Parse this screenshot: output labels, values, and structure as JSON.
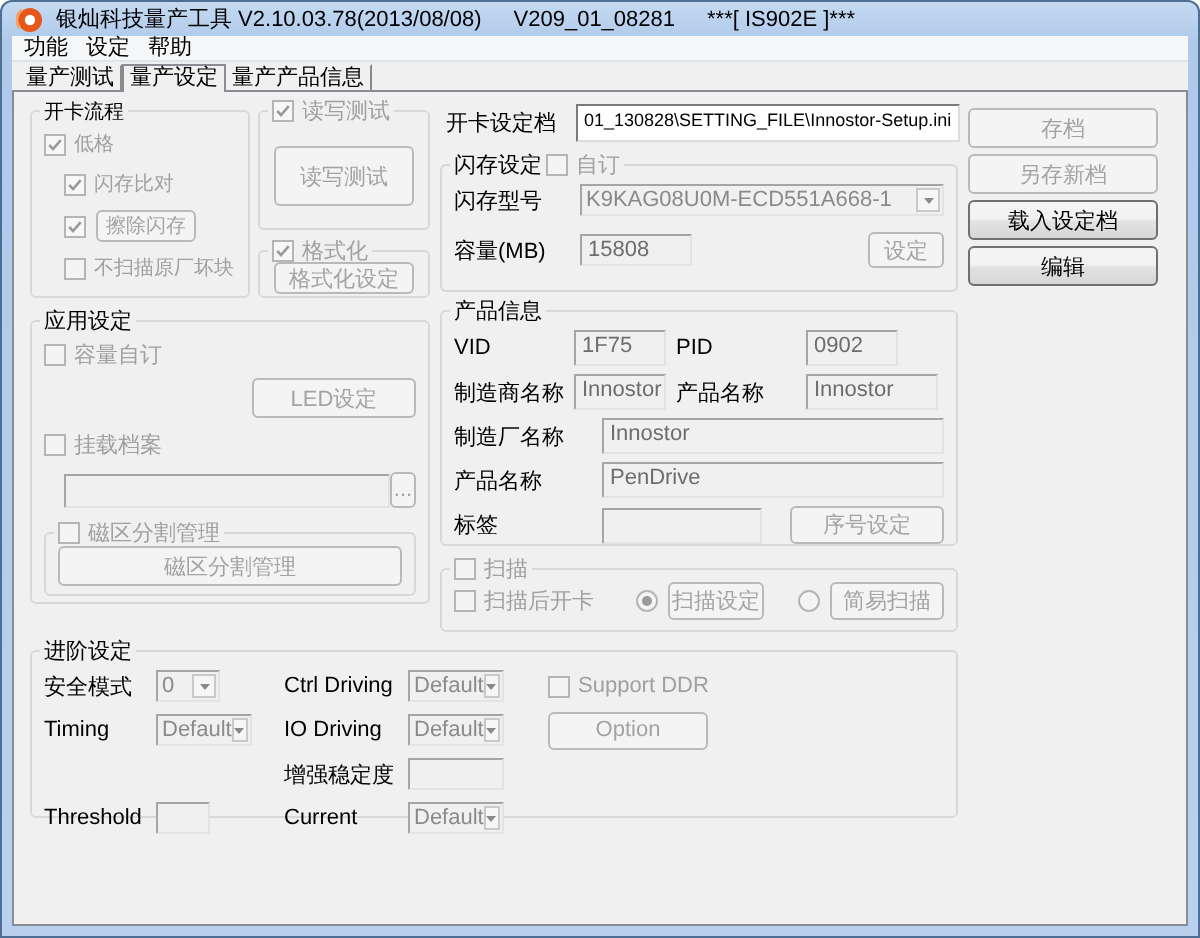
{
  "window": {
    "title": "银灿科技量产工具 V2.10.03.78(2013/08/08)",
    "build": "V209_01_08281",
    "chip": "***[ IS902E ]***"
  },
  "menu": [
    "功能",
    "设定",
    "帮助"
  ],
  "tabs": [
    {
      "label": "量产测试",
      "selected": false
    },
    {
      "label": "量产设定",
      "selected": true
    },
    {
      "label": "量产产品信息",
      "selected": false
    }
  ],
  "flow": {
    "legend": "开卡流程",
    "options": [
      {
        "kind": "checkbox",
        "label": "低格",
        "checked": true
      },
      {
        "kind": "checkbox",
        "label": "闪存比对",
        "checked": true
      },
      {
        "kind": "checkbutton",
        "label": "擦除闪存",
        "checked": true
      },
      {
        "kind": "checkbox",
        "label": "不扫描原厂坏块",
        "checked": false
      }
    ]
  },
  "rw_test": {
    "label": "读写测试",
    "checked": true,
    "button": "读写测试"
  },
  "format": {
    "label": "格式化",
    "checked": true,
    "button": "格式化设定"
  },
  "app_settings": {
    "legend": "应用设定",
    "capacity_custom": {
      "label": "容量自订",
      "checked": false
    },
    "led_button": "LED设定",
    "mount_file": {
      "label": "挂载档案",
      "checked": false
    },
    "browse_button": "...",
    "partition": {
      "label": "磁区分割管理",
      "checked": false,
      "button": "磁区分割管理"
    }
  },
  "settings_file": {
    "label": "开卡设定档",
    "value": "01_130828\\SETTING_FILE\\Innostor-Setup.ini"
  },
  "flash": {
    "legend": "闪存设定",
    "custom": {
      "label": "自订",
      "checked": false
    },
    "model_label": "闪存型号",
    "model": "K9KAG08U0M-ECD551A668-1",
    "capacity_label": "容量(MB)",
    "capacity": "15808",
    "set_button": "设定"
  },
  "product": {
    "legend": "产品信息",
    "vid_label": "VID",
    "vid": "1F75",
    "pid_label": "PID",
    "pid": "0902",
    "vendor_label": "制造商名称",
    "vendor": "Innostor",
    "product_label": "产品名称",
    "product": "Innostor",
    "maker_label": "制造厂名称",
    "maker": "Innostor",
    "name_label": "产品名称",
    "name": "PenDrive",
    "tag_label": "标签",
    "serial_button": "序号设定"
  },
  "scan": {
    "label": "扫描",
    "checked": false,
    "after_scan": {
      "label": "扫描后开卡",
      "checked": false
    },
    "modes": [
      {
        "label": "扫描设定",
        "selected": true
      },
      {
        "label": "简易扫描",
        "selected": false
      }
    ]
  },
  "actions": [
    {
      "label": "存档",
      "disabled": true
    },
    {
      "label": "另存新档",
      "disabled": true
    },
    {
      "label": "载入设定档",
      "disabled": false
    },
    {
      "label": "编辑",
      "disabled": false
    }
  ],
  "advanced": {
    "legend": "进阶设定",
    "rows": [
      {
        "left": {
          "label": "安全模式",
          "kind": "combo",
          "value": "0"
        },
        "right": {
          "label": "Ctrl Driving",
          "kind": "combo",
          "value": "Default"
        }
      },
      {
        "left": {
          "label": "Timing",
          "kind": "combo",
          "value": "Default"
        },
        "right": {
          "label": "IO Driving",
          "kind": "combo",
          "value": "Default"
        }
      },
      {
        "right": {
          "label": "增强稳定度",
          "kind": "input"
        }
      },
      {
        "left": {
          "label": "Threshold",
          "kind": "input"
        },
        "right": {
          "label": "Current",
          "kind": "combo",
          "value": "Default"
        }
      }
    ],
    "ddr": {
      "label": "Support DDR",
      "checked": false
    },
    "option_button": "Option"
  }
}
